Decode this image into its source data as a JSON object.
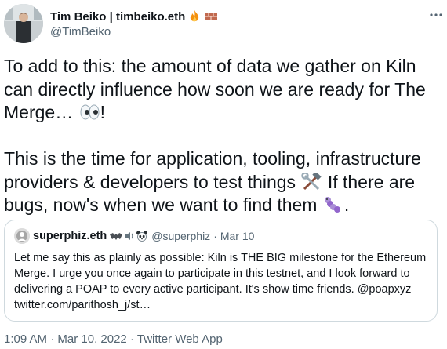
{
  "author": {
    "display_name": "Tim Beiko | timbeiko.eth",
    "handle": "@TimBeiko",
    "emoji": [
      "fire",
      "brick"
    ]
  },
  "more_icon": "more-horizontal-icon",
  "tweet": {
    "paragraph1": "To add to this: the amount of data we gather on Kiln can directly influence how soon we are ready for The Merge…",
    "paragraph1_end": "!",
    "paragraph2_start": "This is the time for application, tooling, infrastructure providers & developers to test things",
    "paragraph2_middle": "If there are bugs, now's when we want to find them",
    "paragraph2_end": "."
  },
  "quote": {
    "name": "superphiz.eth",
    "handle": "@superphiz",
    "date": "Mar 10",
    "separator": "·",
    "text": "Let me say this as plainly as possible: Kiln is THE BIG milestone for the Ethereum Merge. I urge you once again to participate in this testnet, and I look forward to delivering a POAP to every active participant. It's show time friends. @poapxyz twitter.com/parithosh_j/st…"
  },
  "footer": {
    "time": "1:09 AM",
    "date": "Mar 10, 2022",
    "source": "Twitter Web App",
    "separator": "·"
  }
}
